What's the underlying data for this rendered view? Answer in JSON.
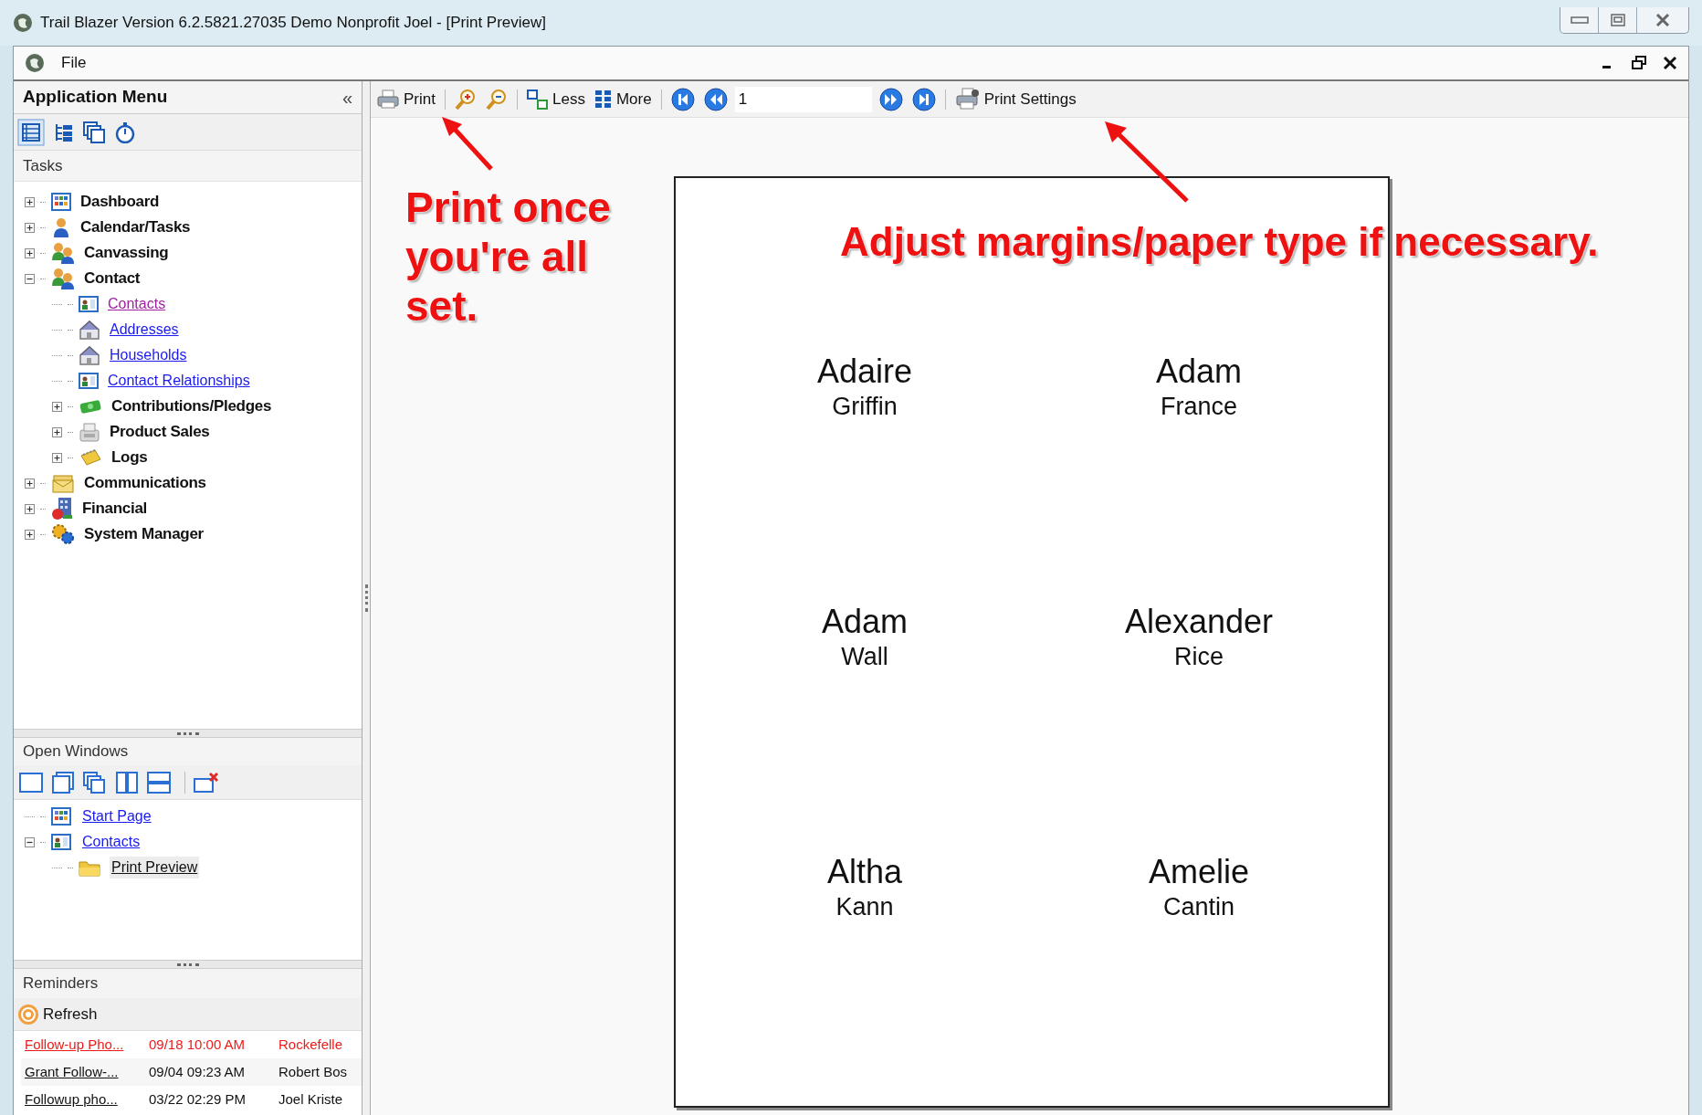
{
  "window": {
    "title": "Trail Blazer Version 6.2.5821.27035 Demo Nonprofit Joel - [Print Preview]"
  },
  "menu_bar": {
    "items": [
      "File"
    ]
  },
  "sidebar": {
    "title": "Application Menu",
    "collapse_glyph": "«",
    "tasks": {
      "title": "Tasks",
      "tree": [
        {
          "label": "Dashboard",
          "kind": "group",
          "expanded": false
        },
        {
          "label": "Calendar/Tasks",
          "kind": "group",
          "expanded": false
        },
        {
          "label": "Canvassing",
          "kind": "group",
          "expanded": false
        },
        {
          "label": "Contact",
          "kind": "group",
          "expanded": true,
          "children": [
            {
              "label": "Contacts",
              "kind": "link",
              "visited": true
            },
            {
              "label": "Addresses",
              "kind": "link",
              "visited": false
            },
            {
              "label": "Households",
              "kind": "link",
              "visited": false
            },
            {
              "label": "Contact Relationships",
              "kind": "link",
              "visited": false
            },
            {
              "label": "Contributions/Pledges",
              "kind": "group",
              "expanded": false
            },
            {
              "label": "Product Sales",
              "kind": "group",
              "expanded": false
            },
            {
              "label": "Logs",
              "kind": "group",
              "expanded": false
            }
          ]
        },
        {
          "label": "Communications",
          "kind": "group",
          "expanded": false
        },
        {
          "label": "Financial",
          "kind": "group",
          "expanded": false
        },
        {
          "label": "System Manager",
          "kind": "group",
          "expanded": false
        }
      ]
    },
    "open_windows": {
      "title": "Open Windows",
      "tree": [
        {
          "label": "Start Page",
          "selected": false
        },
        {
          "label": "Contacts",
          "selected": false,
          "expanded": true,
          "children": [
            {
              "label": "Print Preview",
              "selected": true
            }
          ]
        }
      ]
    },
    "reminders": {
      "title": "Reminders",
      "refresh": "Refresh",
      "rows": [
        {
          "subject": "Follow-up Pho...",
          "due": "09/18 10:00 AM",
          "contact": "Rockefelle",
          "overdue": true
        },
        {
          "subject": "Grant Follow-...",
          "due": "09/04 09:23 AM",
          "contact": "Robert Bos",
          "overdue": false
        },
        {
          "subject": "Followup pho...",
          "due": "03/22 02:29 PM",
          "contact": "Joel Kriste",
          "overdue": false
        }
      ]
    }
  },
  "toolbar": {
    "print": "Print",
    "less": "Less",
    "more": "More",
    "page": "1",
    "print_settings": "Print Settings"
  },
  "preview": {
    "labels": [
      {
        "first": "Adaire",
        "last": "Griffin"
      },
      {
        "first": "Adam",
        "last": "France"
      },
      {
        "first": "Adam",
        "last": "Wall"
      },
      {
        "first": "Alexander",
        "last": "Rice"
      },
      {
        "first": "Altha",
        "last": "Kann"
      },
      {
        "first": "Amelie",
        "last": "Cantin"
      }
    ]
  },
  "annotations": [
    "Print once you're all set.",
    "Adjust margins/paper type if necessary."
  ]
}
